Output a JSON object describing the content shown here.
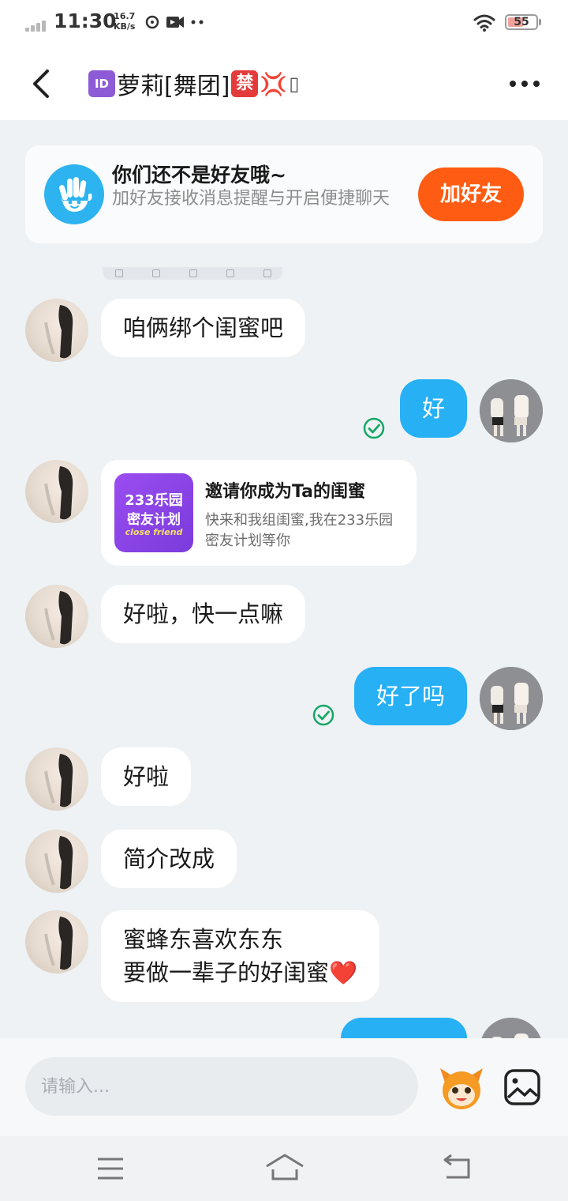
{
  "status_bar": {
    "time": "11:30",
    "net_speed_value": "16.7",
    "net_speed_unit": "KB/s",
    "battery": "55",
    "battery_level": 0.55
  },
  "header": {
    "title_prefix_badge": "ID",
    "title_name": "萝莉[舞团]",
    "title_badge_ban": "禁",
    "title_anger_emoji": "💢",
    "title_tail": "▯"
  },
  "friend_banner": {
    "title": "你们还不是好友哦~",
    "subtitle": "加好友接收消息提醒与开启便捷聊天",
    "button_label": "加好友"
  },
  "messages": [
    {
      "from": "them",
      "text": "咱俩绑个闺蜜吧"
    },
    {
      "from": "me",
      "text": "好",
      "read": true
    },
    {
      "from": "them",
      "type": "invite_card",
      "card": {
        "logo_line1": "233乐园",
        "logo_line2": "密友计划",
        "logo_line3": "close friend",
        "title": "邀请你成为Ta的闺蜜",
        "desc": "快来和我组闺蜜,我在233乐园密友计划等你"
      }
    },
    {
      "from": "them",
      "text": "好啦，快一点嘛"
    },
    {
      "from": "me",
      "text": "好了吗",
      "read": true
    },
    {
      "from": "them",
      "text": "好啦"
    },
    {
      "from": "them",
      "text": "简介改成"
    },
    {
      "from": "them",
      "lines": [
        "蜜蜂东喜欢东东",
        "要做一辈子的好闺蜜❤️"
      ]
    },
    {
      "from": "me",
      "text": "",
      "partially_visible": true
    }
  ],
  "input_bar": {
    "placeholder": "请输入..."
  },
  "colors": {
    "accent_blue": "#27b0f4",
    "add_friend_orange": "#fe5c12",
    "read_check_green": "#16a765",
    "chat_background": "#eef2f5"
  },
  "icons": {
    "header_back": "chevron-left-icon",
    "header_more": "more-dots-icon",
    "banner": "waving-hand-icon",
    "read_receipt": "check-circle-icon",
    "emoji_mascot": "mascot-face-icon",
    "image_picker": "image-icon",
    "nav_menu": "menu-icon",
    "nav_home": "home-icon",
    "nav_back": "back-icon"
  }
}
